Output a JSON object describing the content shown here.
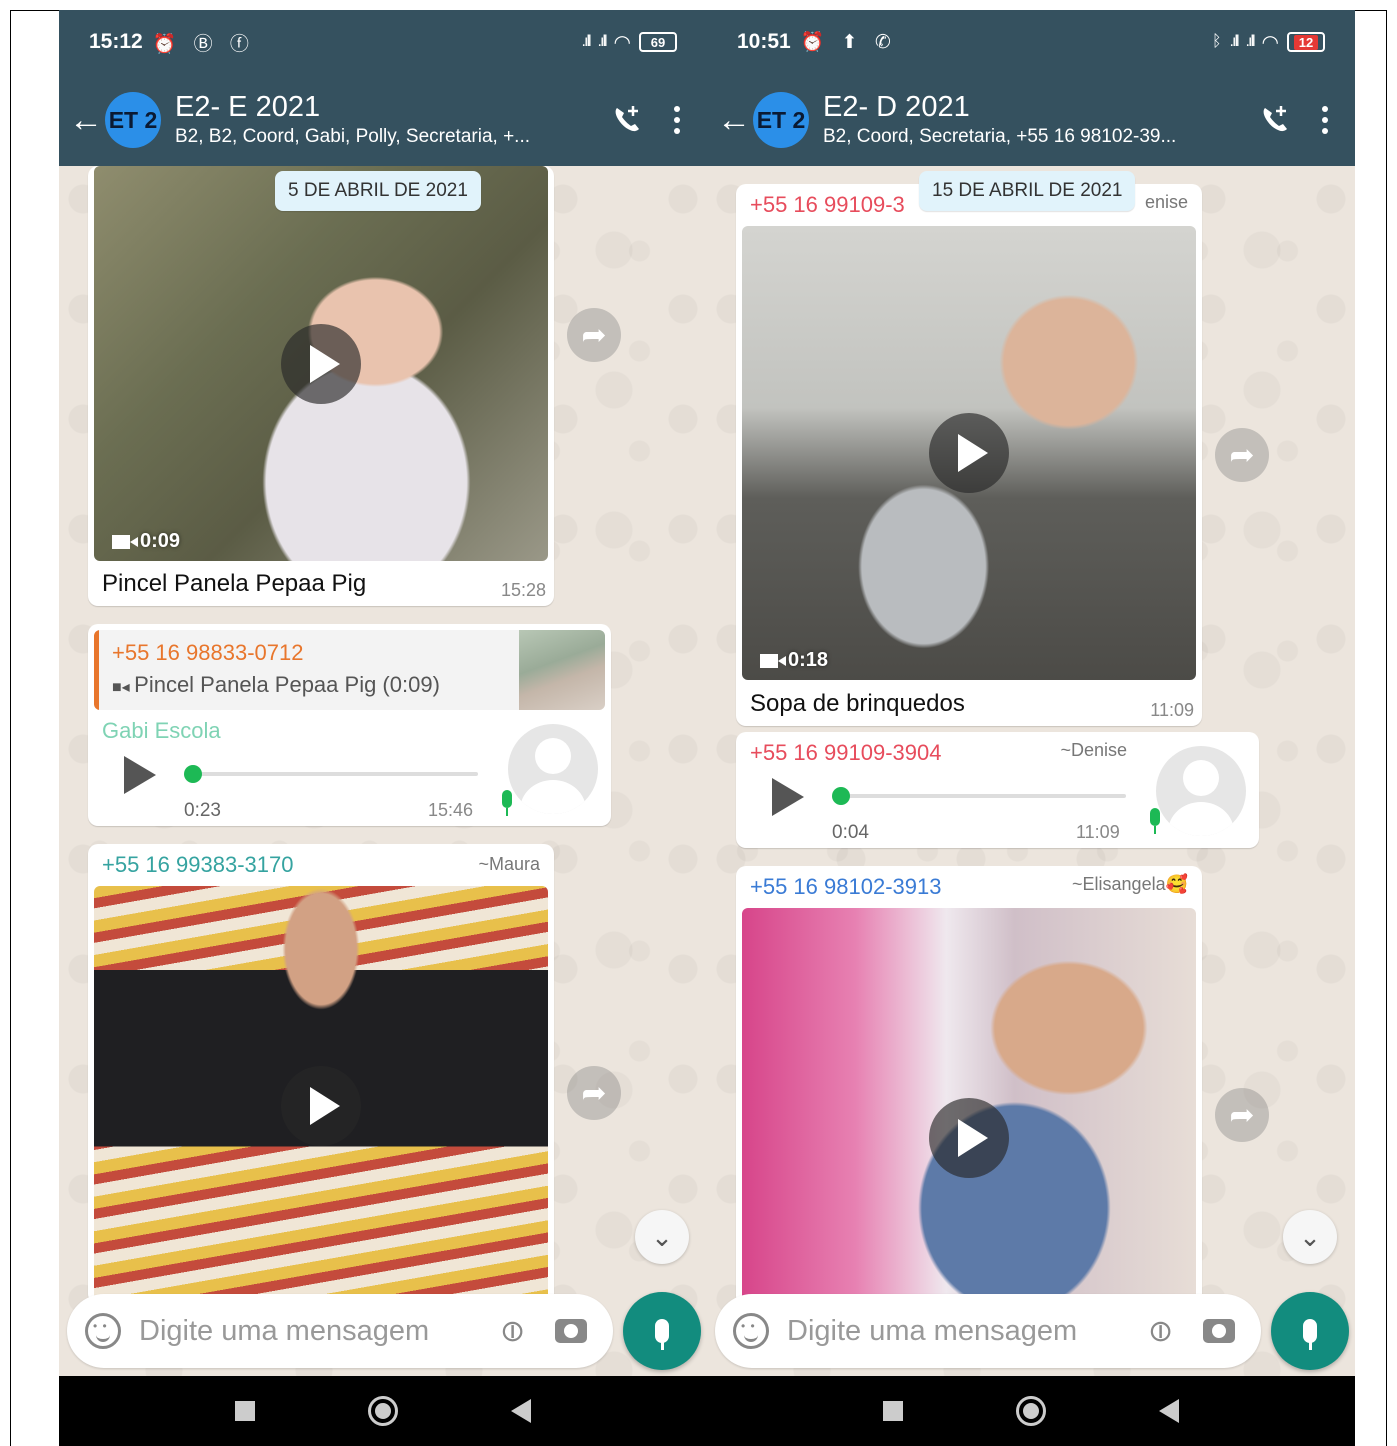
{
  "left": {
    "status": {
      "time": "15:12",
      "icons": "⏰ Ⓑ ⓕ",
      "battery": "69"
    },
    "header": {
      "avatar": "ET 2",
      "title": "E2- E 2021",
      "subtitle": "B2, B2, Coord, Gabi, Polly, Secretaria, +..."
    },
    "date_chip": "5 DE ABRIL DE 2021",
    "video1": {
      "duration": "0:09",
      "caption": "Pincel Panela Pepaa Pig",
      "time": "15:28"
    },
    "voice": {
      "quote_sender": "+55 16 98833-0712",
      "quote_text": "Pincel Panela Pepaa Pig (0:09)",
      "sender": "Gabi Escola",
      "length": "0:23",
      "time": "15:46"
    },
    "video2": {
      "sender": "+55 16 99383-3170",
      "tag": "~Maura"
    },
    "composer": {
      "placeholder": "Digite uma mensagem"
    }
  },
  "right": {
    "status": {
      "time": "10:51",
      "icons": "⏰ ⬆ ✆",
      "battery": "12"
    },
    "header": {
      "avatar": "ET 2",
      "title": "E2- D 2021",
      "subtitle": "B2, Coord, Secretaria, +55 16 98102-39..."
    },
    "date_chip": "15 DE ABRIL DE 2021",
    "video1": {
      "sender": "+55 16 99109-3",
      "tag": "enise",
      "duration": "0:18",
      "caption": "Sopa de brinquedos",
      "time": "11:09"
    },
    "voice": {
      "sender": "+55 16 99109-3904",
      "tag": "~Denise",
      "length": "0:04",
      "time": "11:09"
    },
    "video2": {
      "sender": "+55 16 98102-3913",
      "tag": "~Elisangela🥰"
    },
    "composer": {
      "placeholder": "Digite uma mensagem"
    }
  },
  "colors": {
    "header": "#35515f",
    "accent": "#128c7e",
    "voice_dot": "#1db955",
    "quote": "#e8762c",
    "sender_red": "#e74c5c",
    "sender_teal": "#35a3a0"
  }
}
